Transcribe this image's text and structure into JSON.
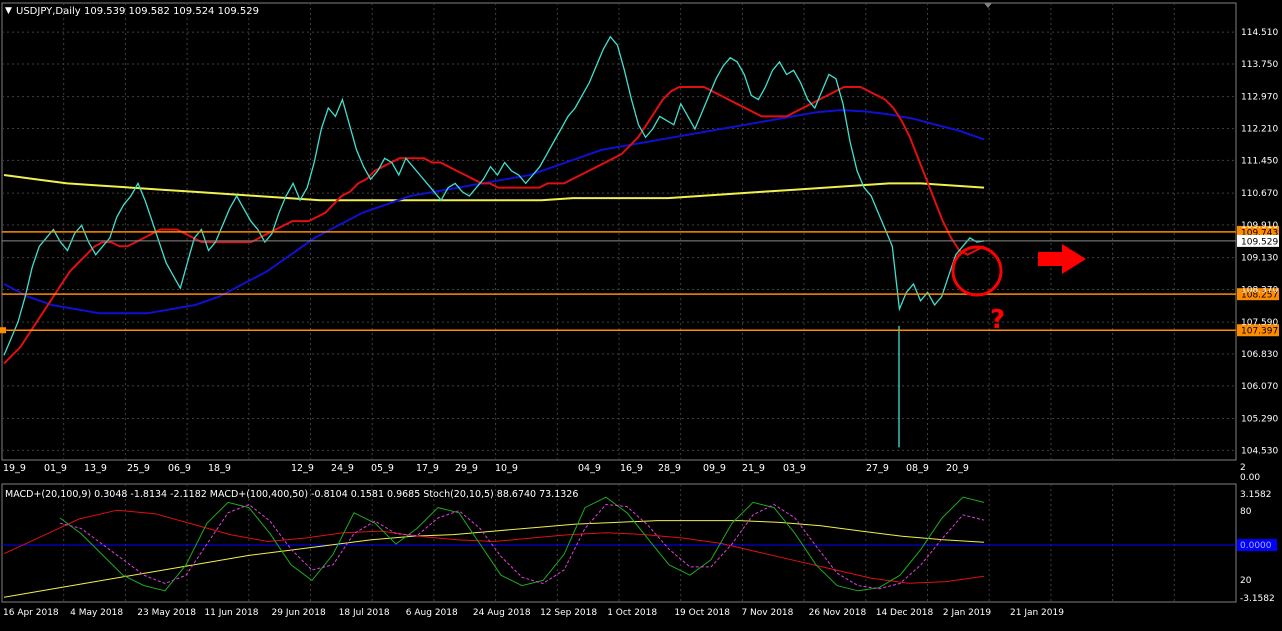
{
  "header": {
    "symbol_label": "USDJPY,Daily",
    "ohlc": "109.539 109.582 109.524 109.529"
  },
  "colors": {
    "background": "#000000",
    "grid": "#404040",
    "price_line": "#40e0d0",
    "ma_red": "#e01010",
    "ma_blue": "#1010d0",
    "ma_yellow": "#f0f050",
    "level_orange": "#ff8c00",
    "annotation_red": "#ff0000",
    "macd_green": "#1faa1f",
    "stoch_magenta": "#e040e0",
    "zero_line": "#0000ff"
  },
  "chart_data": [
    {
      "type": "line",
      "name": "main-price-panel",
      "title": "USDJPY,Daily",
      "ohlc": "109.539 109.582 109.524 109.529",
      "ylim": [
        104.3,
        114.8
      ],
      "x": [
        "16 Apr 2018",
        "4 May 2018",
        "23 May 2018",
        "11 Jun 2018",
        "29 Jun 2018",
        "18 Jul 2018",
        "6 Aug 2018",
        "24 Aug 2018",
        "12 Sep 2018",
        "1 Oct 2018",
        "19 Oct 2018",
        "7 Nov 2018",
        "26 Nov 2018",
        "14 Dec 2018",
        "2 Jan 2019",
        "21 Jan 2019"
      ],
      "y_ticks": [
        "114.510",
        "113.750",
        "112.970",
        "112.210",
        "111.450",
        "110.670",
        "109.910",
        "109.130",
        "108.370",
        "107.590",
        "106.830",
        "106.070",
        "105.290",
        "104.530"
      ],
      "y_tick_values": [
        114.51,
        113.75,
        112.97,
        112.21,
        111.45,
        110.67,
        109.91,
        109.13,
        108.37,
        107.59,
        106.83,
        106.07,
        105.29,
        104.53
      ],
      "horizontal_levels": [
        {
          "label": "109.743",
          "value": 109.743
        },
        {
          "label": "108.257",
          "value": 108.257
        },
        {
          "label": "107.397",
          "value": 107.397
        }
      ],
      "current_price": {
        "label": "109.529",
        "value": 109.529
      },
      "series": [
        {
          "key": "price",
          "values": [
            106.8,
            107.2,
            107.6,
            108.2,
            108.9,
            109.4,
            109.6,
            109.8,
            109.5,
            109.3,
            109.7,
            109.9,
            109.5,
            109.2,
            109.4,
            109.6,
            110.1,
            110.4,
            110.6,
            110.9,
            110.5,
            110.0,
            109.5,
            109.0,
            108.7,
            108.4,
            109.0,
            109.6,
            109.8,
            109.3,
            109.5,
            109.9,
            110.3,
            110.6,
            110.3,
            110.0,
            109.8,
            109.5,
            109.7,
            110.2,
            110.6,
            110.9,
            110.5,
            110.8,
            111.4,
            112.2,
            112.7,
            112.5,
            112.9,
            112.3,
            111.7,
            111.3,
            111.0,
            111.2,
            111.5,
            111.4,
            111.1,
            111.5,
            111.3,
            111.1,
            110.9,
            110.7,
            110.5,
            110.8,
            110.9,
            110.7,
            110.6,
            110.8,
            111.0,
            111.3,
            111.1,
            111.4,
            111.2,
            111.1,
            110.9,
            111.1,
            111.3,
            111.6,
            111.9,
            112.2,
            112.5,
            112.7,
            113.0,
            113.3,
            113.7,
            114.1,
            114.4,
            114.2,
            113.6,
            112.9,
            112.3,
            112.0,
            112.2,
            112.5,
            112.4,
            112.3,
            112.8,
            112.5,
            112.2,
            112.6,
            113.0,
            113.4,
            113.7,
            113.9,
            113.8,
            113.5,
            113.0,
            112.9,
            113.2,
            113.6,
            113.8,
            113.5,
            113.6,
            113.3,
            112.9,
            112.7,
            113.1,
            113.5,
            113.4,
            112.8,
            111.9,
            111.2,
            110.8,
            110.6,
            110.2,
            109.8,
            109.4,
            107.9,
            108.3,
            108.5,
            108.1,
            108.3,
            108.0,
            108.2,
            108.7,
            109.2,
            109.4,
            109.6,
            109.5,
            109.53
          ]
        },
        {
          "key": "ma_red",
          "values": [
            106.6,
            106.8,
            107.0,
            107.3,
            107.6,
            107.9,
            108.2,
            108.5,
            108.8,
            109.0,
            109.2,
            109.4,
            109.5,
            109.5,
            109.4,
            109.4,
            109.5,
            109.6,
            109.7,
            109.8,
            109.8,
            109.8,
            109.7,
            109.6,
            109.5,
            109.5,
            109.5,
            109.5,
            109.5,
            109.5,
            109.5,
            109.6,
            109.7,
            109.8,
            109.9,
            110.0,
            110.0,
            110.0,
            110.1,
            110.2,
            110.4,
            110.6,
            110.7,
            110.9,
            111.0,
            111.2,
            111.3,
            111.4,
            111.5,
            111.5,
            111.5,
            111.5,
            111.4,
            111.4,
            111.3,
            111.2,
            111.1,
            111.0,
            110.9,
            110.9,
            110.8,
            110.8,
            110.8,
            110.8,
            110.8,
            110.8,
            110.9,
            110.9,
            110.9,
            111.0,
            111.1,
            111.2,
            111.3,
            111.4,
            111.5,
            111.6,
            111.8,
            112.0,
            112.3,
            112.6,
            112.9,
            113.1,
            113.2,
            113.2,
            113.2,
            113.2,
            113.1,
            113.0,
            112.9,
            112.8,
            112.7,
            112.6,
            112.5,
            112.5,
            112.5,
            112.5,
            112.6,
            112.7,
            112.8,
            112.9,
            113.0,
            113.1,
            113.2,
            113.2,
            113.2,
            113.1,
            113.0,
            112.9,
            112.7,
            112.4,
            112.0,
            111.5,
            111.0,
            110.5,
            110.0,
            109.6,
            109.3,
            109.2,
            109.3,
            109.4
          ]
        },
        {
          "key": "ma_blue",
          "values": [
            108.5,
            108.2,
            108.0,
            107.9,
            107.8,
            107.8,
            107.8,
            107.9,
            108.0,
            108.2,
            108.5,
            108.8,
            109.2,
            109.6,
            109.9,
            110.2,
            110.4,
            110.6,
            110.7,
            110.8,
            110.9,
            111.0,
            111.1,
            111.3,
            111.5,
            111.7,
            111.8,
            111.9,
            112.0,
            112.1,
            112.2,
            112.3,
            112.4,
            112.5,
            112.6,
            112.65,
            112.62,
            112.55,
            112.45,
            112.3,
            112.15,
            111.95
          ]
        },
        {
          "key": "ma_yellow",
          "values": [
            111.1,
            111.0,
            110.9,
            110.85,
            110.8,
            110.75,
            110.7,
            110.65,
            110.6,
            110.55,
            110.5,
            110.5,
            110.5,
            110.5,
            110.5,
            110.5,
            110.5,
            110.5,
            110.55,
            110.55,
            110.55,
            110.55,
            110.6,
            110.65,
            110.7,
            110.75,
            110.8,
            110.85,
            110.9,
            110.9,
            110.85,
            110.8
          ]
        }
      ],
      "period_labels": [
        "19_9",
        "01_9",
        "13_9",
        "25_9",
        "06_9",
        "18_9",
        "12_9",
        "24_9",
        "05_9",
        "17_9",
        "29_9",
        "10_9",
        "04_9",
        "16_9",
        "28_9",
        "09_9",
        "21_9",
        "03_9",
        "27_9",
        "08_9",
        "20_9"
      ]
    },
    {
      "type": "line",
      "name": "indicator-panel",
      "title": "MACD+(20,100,9) 0.3048 -1.8134 -2.1182  MACD+(100,400,50) -0.8104 0.1581 0.9685  Stoch(20,10,5) 88.6740 73.1326",
      "separator_labels": [
        "2",
        "0.00"
      ],
      "y_ticks": [
        "3.1582",
        "80",
        "0.0000",
        "20",
        "-3.1582"
      ],
      "ylim": [
        -3.1582,
        3.1582
      ],
      "series": [
        {
          "key": "green",
          "values": [
            75,
            60,
            40,
            20,
            10,
            5,
            30,
            70,
            90,
            85,
            60,
            30,
            15,
            40,
            80,
            70,
            50,
            65,
            85,
            80,
            50,
            20,
            10,
            15,
            40,
            85,
            95,
            80,
            55,
            30,
            20,
            35,
            70,
            90,
            85,
            60,
            30,
            10,
            5,
            8,
            20,
            45,
            75,
            95,
            90
          ]
        },
        {
          "key": "magenta",
          "values": [
            70,
            65,
            50,
            35,
            20,
            12,
            20,
            50,
            80,
            88,
            72,
            45,
            25,
            30,
            60,
            72,
            60,
            58,
            75,
            82,
            65,
            38,
            18,
            12,
            25,
            65,
            88,
            86,
            68,
            45,
            28,
            28,
            50,
            78,
            88,
            75,
            48,
            22,
            10,
            7,
            12,
            30,
            55,
            78,
            73
          ]
        },
        {
          "key": "red",
          "values": [
            -0.5,
            0.5,
            1.5,
            2.0,
            1.8,
            1.2,
            0.6,
            0.2,
            0.4,
            0.7,
            0.8,
            0.5,
            0.3,
            0.2,
            0.4,
            0.6,
            0.7,
            0.6,
            0.4,
            0.1,
            -0.4,
            -0.9,
            -1.4,
            -1.9,
            -2.2,
            -2.1,
            -1.8
          ]
        },
        {
          "key": "yellow",
          "values": [
            -3.0,
            -2.6,
            -2.2,
            -1.8,
            -1.4,
            -1.0,
            -0.6,
            -0.3,
            0.0,
            0.3,
            0.5,
            0.6,
            0.8,
            1.0,
            1.2,
            1.3,
            1.4,
            1.4,
            1.4,
            1.3,
            1.1,
            0.8,
            0.5,
            0.3,
            0.16
          ]
        },
        {
          "key": "zero",
          "values": [
            0,
            0
          ]
        }
      ]
    }
  ],
  "annotations": {
    "question_mark": "?",
    "arrow": "right-arrow-icon",
    "circle": "circle-highlight"
  }
}
